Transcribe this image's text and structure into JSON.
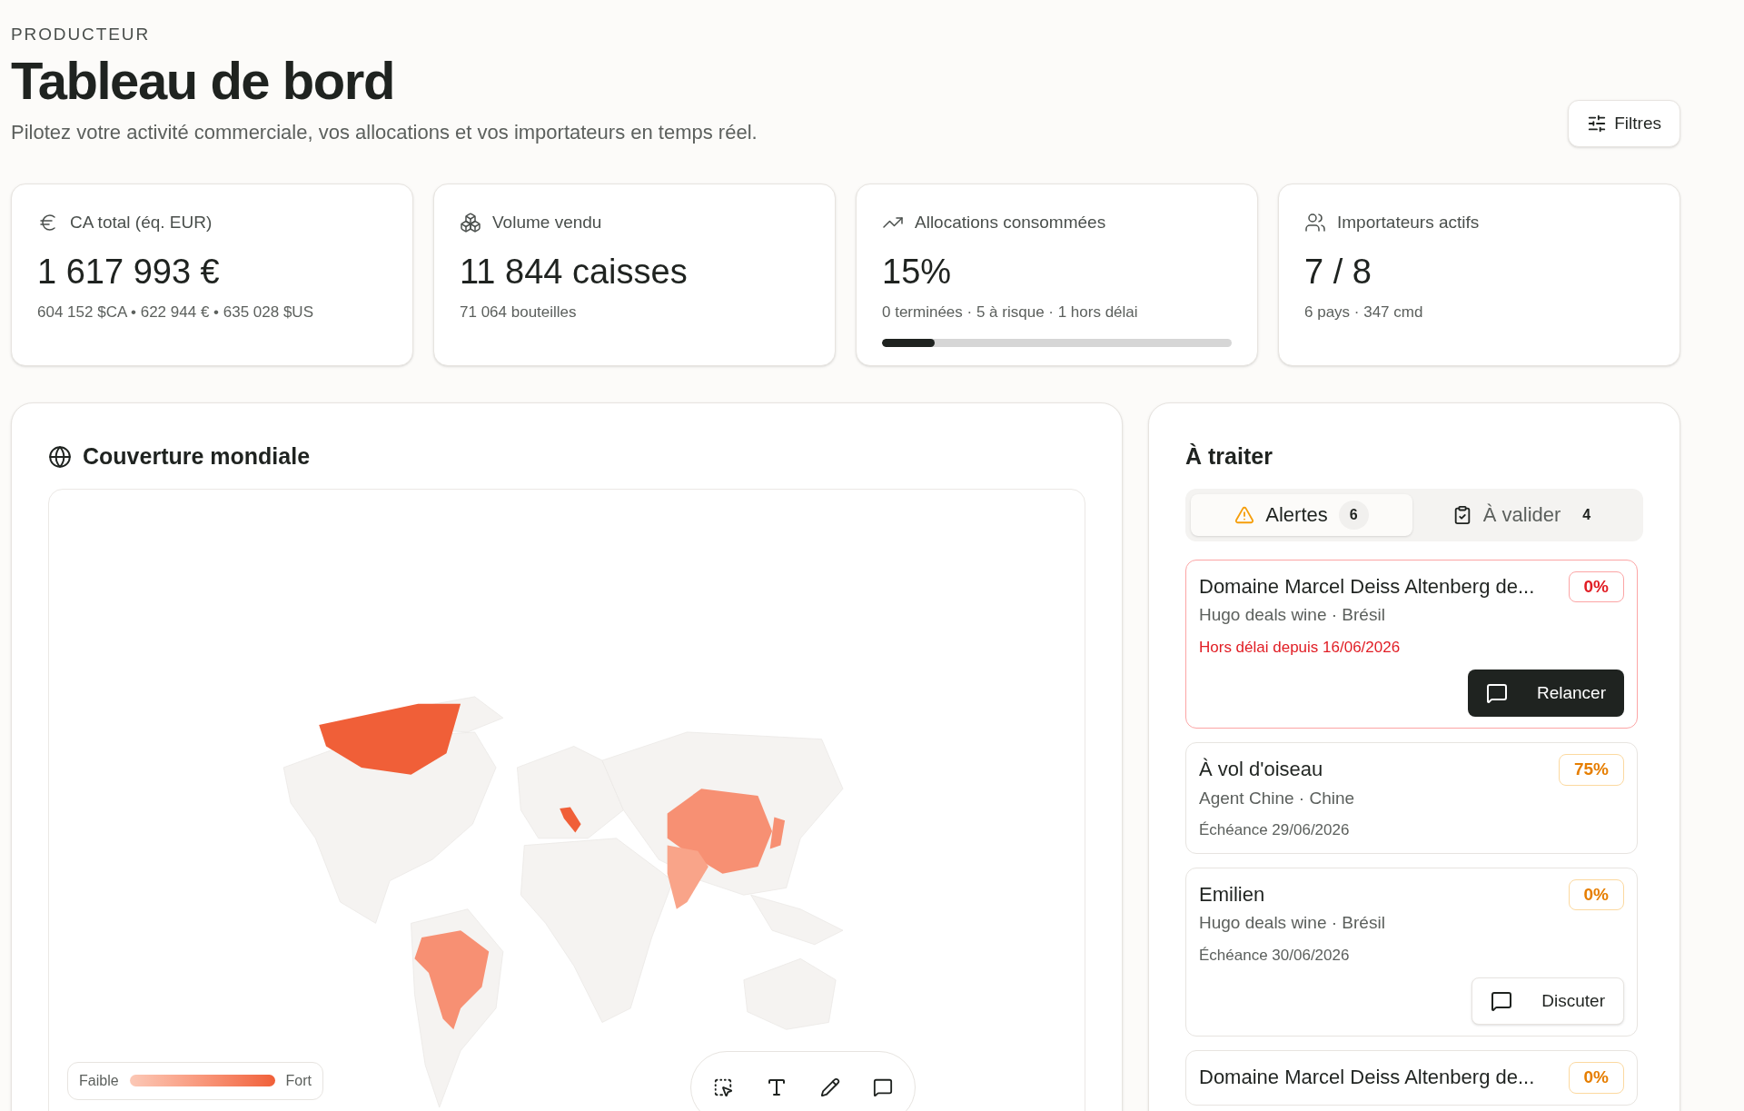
{
  "header": {
    "eyebrow": "PRODUCTEUR",
    "title": "Tableau de bord",
    "subtitle": "Pilotez votre activité commerciale, vos allocations et vos importateurs en temps réel.",
    "filters_button": "Filtres"
  },
  "kpis": [
    {
      "kind": "euro",
      "label": "CA total (éq. EUR)",
      "value": "1 617 993 €",
      "detail": "604 152 $CA • 622 944 € • 635 028 $US"
    },
    {
      "kind": "boxes",
      "label": "Volume vendu",
      "value": "11 844 caisses",
      "detail": "71 064 bouteilles"
    },
    {
      "kind": "trend",
      "label": "Allocations consommées",
      "value": "15%",
      "detail": "0 terminées · 5 à risque · 1 hors délai",
      "level": 0.15
    },
    {
      "kind": "users",
      "label": "Importateurs actifs",
      "value": "7 / 8",
      "detail": "6 pays · 347 cmd"
    }
  ],
  "coverage": {
    "title": "Couverture mondiale",
    "legend": {
      "low": "Faible",
      "high": "Fort"
    }
  },
  "todo": {
    "title": "À traiter",
    "tabs": [
      {
        "kind": "alert",
        "label": "Alertes",
        "count": "6",
        "selected": true
      },
      {
        "kind": "clipboard",
        "label": "À valider",
        "count": "4",
        "selected": false
      }
    ],
    "items": [
      {
        "title": "Domaine Marcel Deiss Altenberg de...",
        "subtitle": "Hugo deals wine · Brésil",
        "note": "Hors délai depuis 16/06/2026",
        "badge": "0%",
        "overdue": true,
        "action": {
          "kind": "primary",
          "label": "Relancer"
        }
      },
      {
        "title": "À vol d'oiseau",
        "subtitle": "Agent Chine · Chine",
        "note": "Échéance 29/06/2026",
        "badge": "75%",
        "overdue": false
      },
      {
        "title": "Emilien",
        "subtitle": "Hugo deals wine · Brésil",
        "note": "Échéance 30/06/2026",
        "badge": "0%",
        "overdue": false,
        "action": {
          "kind": "secondary",
          "label": "Discuter"
        }
      },
      {
        "title": "Domaine Marcel Deiss Altenberg de...",
        "badge": "0%",
        "overdue": false
      }
    ]
  }
}
